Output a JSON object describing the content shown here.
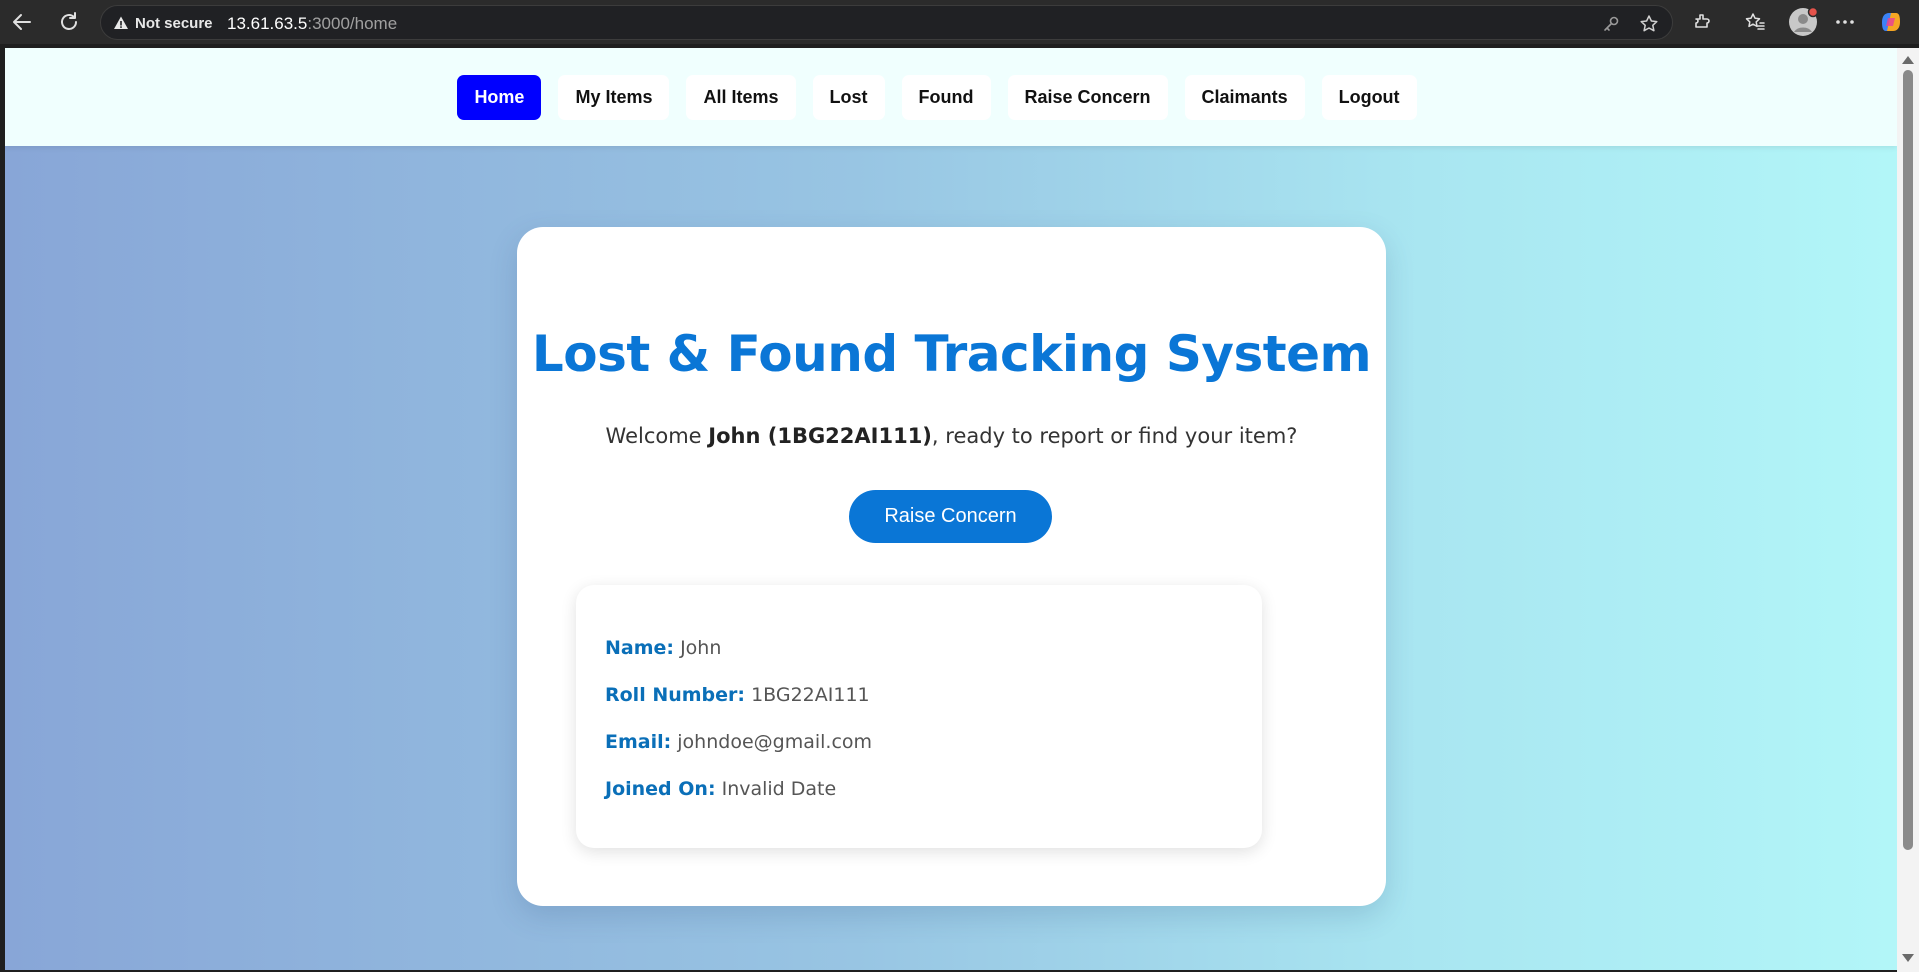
{
  "browser": {
    "security_label": "Not secure",
    "url_host": "13.61.63.5",
    "url_rest": ":3000/home"
  },
  "nav": {
    "items": [
      "Home",
      "My Items",
      "All Items",
      "Lost",
      "Found",
      "Raise Concern",
      "Claimants",
      "Logout"
    ],
    "active": "Home"
  },
  "main": {
    "title": "Lost & Found Tracking System",
    "welcome_prefix": "Welcome ",
    "welcome_user": "John (1BG22AI111)",
    "welcome_suffix": ", ready to report or find your item?",
    "cta_label": "Raise Concern"
  },
  "profile": {
    "name_label": "Name:",
    "name_value": "John",
    "roll_label": "Roll Number:",
    "roll_value": "1BG22AI111",
    "email_label": "Email:",
    "email_value": "johndoe@gmail.com",
    "joined_label": "Joined On:",
    "joined_value": "Invalid Date"
  },
  "colors": {
    "accent": "#0a76d6",
    "nav_active": "#0000ff",
    "label": "#0a6fb8"
  },
  "icons": [
    "back-arrow-icon",
    "reload-icon",
    "warning-icon",
    "key-icon",
    "star-icon",
    "extensions-icon",
    "favorites-icon",
    "profile-avatar-icon",
    "more-icon",
    "copilot-icon"
  ]
}
